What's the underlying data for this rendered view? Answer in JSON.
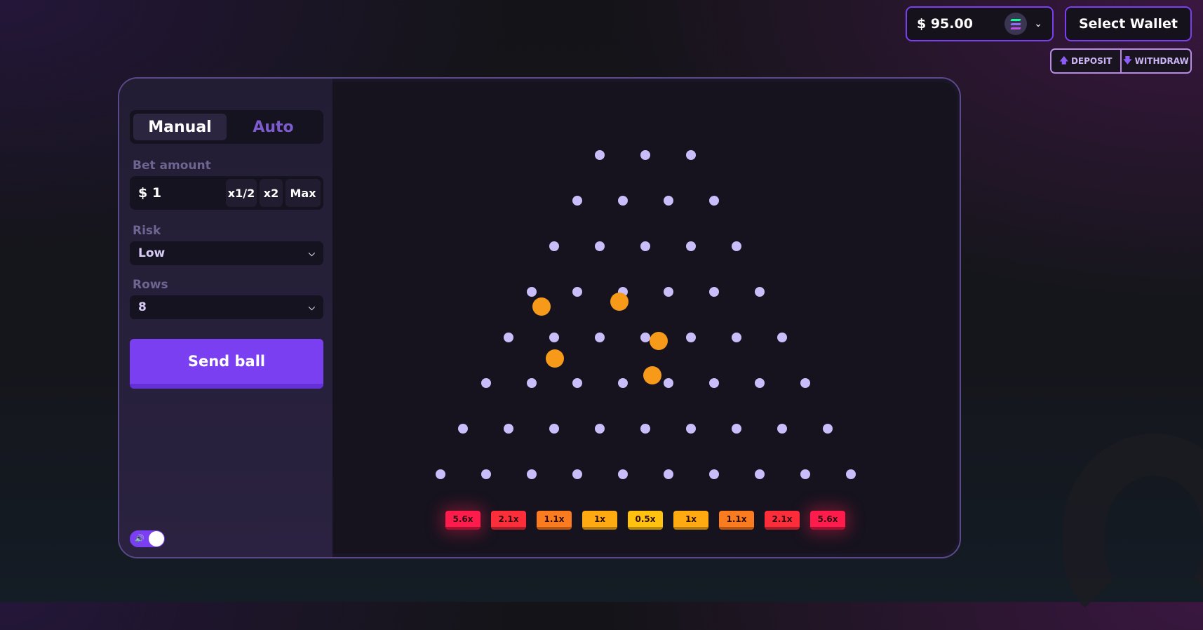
{
  "header": {
    "balance": "$ 95.00",
    "select_wallet": "Select Wallet",
    "deposit": "DEPOSIT",
    "withdraw": "WITHDRAW"
  },
  "sidebar": {
    "tabs": [
      "Manual",
      "Auto"
    ],
    "bet_label": "Bet amount",
    "bet_value": "$ 1",
    "bet_buttons": [
      "x1/2",
      "x2",
      "Max"
    ],
    "risk_label": "Risk",
    "risk_value": "Low",
    "rows_label": "Rows",
    "rows_value": "8",
    "send_label": "Send ball",
    "sound_on": true
  },
  "board": {
    "rows": 8,
    "multipliers": [
      "5.6x",
      "2.1x",
      "1.1x",
      "1x",
      "0.5x",
      "1x",
      "1.1x",
      "2.1x",
      "5.6x"
    ],
    "ball_count": 5
  },
  "colors": {
    "accent": "#7b3ff2",
    "peg": "#c9bdfa",
    "ball": "#f79a1a",
    "slots": [
      "#ff1c4d",
      "#fe2d3a",
      "#fb7c1f",
      "#ffaa10",
      "#ffc20e",
      "#ffaa10",
      "#fb7c1f",
      "#fe2d3a",
      "#ff1c4d"
    ],
    "slot_shadows": [
      "#a80f32",
      "#a91d27",
      "#b85510",
      "#b87a08",
      "#b88a06",
      "#b87a08",
      "#b85510",
      "#a91d27",
      "#a80f32"
    ]
  }
}
